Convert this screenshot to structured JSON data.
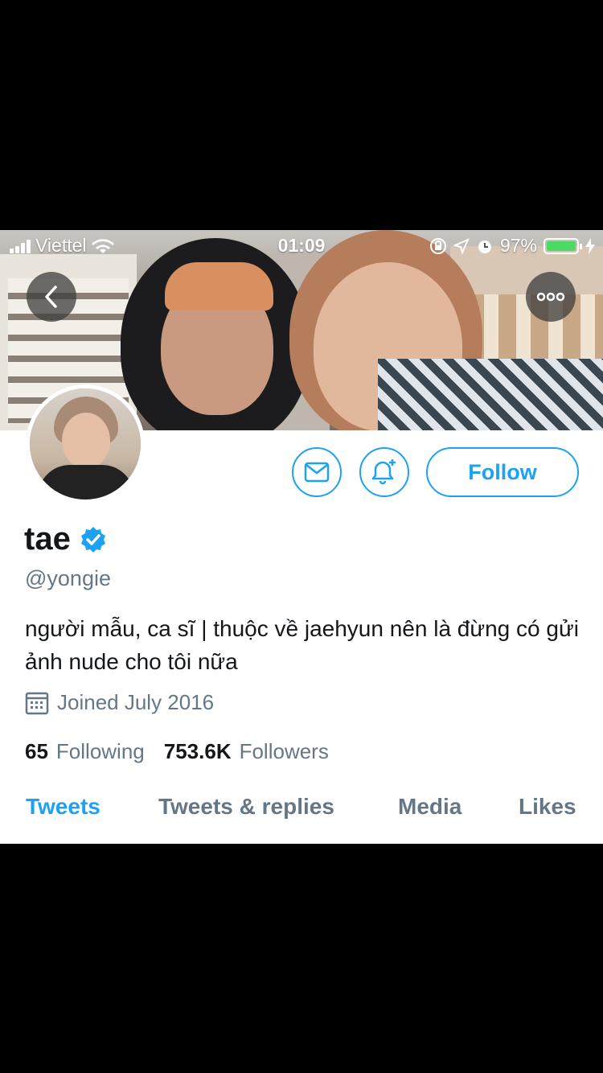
{
  "status_bar": {
    "carrier": "Viettel",
    "time": "01:09",
    "battery_percent": "97%",
    "battery_level": 0.97,
    "battery_color": "#4cd964"
  },
  "header": {
    "back_icon": "chevron-left-icon",
    "more_icon": "ellipsis-icon"
  },
  "actions": {
    "message_icon": "envelope-icon",
    "notify_icon": "bell-plus-icon",
    "follow_label": "Follow"
  },
  "profile": {
    "name": "tae",
    "verified": true,
    "handle": "@yongie",
    "bio": "người mẫu, ca sĩ | thuộc về jaehyun nên là đừng có gửi ảnh nude cho tôi nữa",
    "joined": "Joined July 2016",
    "following_count": "65",
    "following_label": "Following",
    "followers_count": "753.6K",
    "followers_label": "Followers"
  },
  "tabs": [
    {
      "label": "Tweets",
      "active": true
    },
    {
      "label": "Tweets & replies",
      "active": false
    },
    {
      "label": "Media",
      "active": false
    },
    {
      "label": "Likes",
      "active": false
    }
  ],
  "colors": {
    "accent": "#1da1f2",
    "secondary_text": "#657786",
    "primary_text": "#14171a"
  }
}
